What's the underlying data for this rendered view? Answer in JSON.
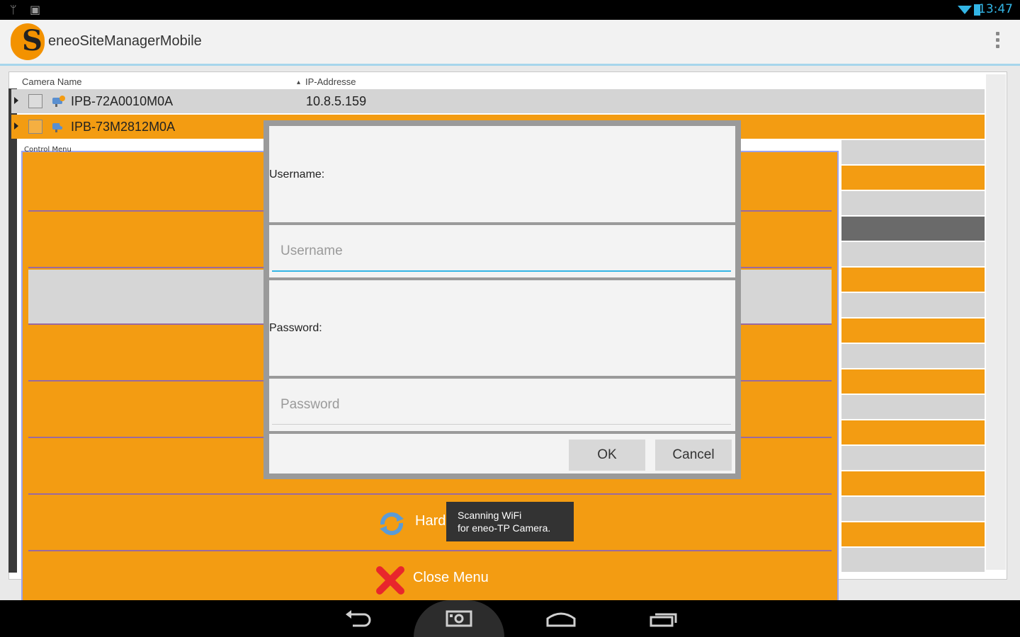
{
  "status_bar": {
    "time": "13:47"
  },
  "app": {
    "title": "eneoSiteManagerMobile"
  },
  "table": {
    "headers": {
      "camera_name": "Camera Name",
      "ip_address": "IP-Addresse"
    },
    "rows": [
      {
        "name": "IPB-72A0010M0A",
        "ip": "10.8.5.159"
      },
      {
        "name": "IPB-73M2812M0A",
        "ip": ""
      }
    ]
  },
  "control_menu": {
    "legend": "Control Menu",
    "hard_label": "Hard",
    "close_label": "Close Menu"
  },
  "dialog": {
    "username_label": "Username:",
    "username_placeholder": "Username",
    "password_label": "Password:",
    "password_placeholder": "Password",
    "ok_label": "OK",
    "cancel_label": "Cancel"
  },
  "toast": {
    "line1": "Scanning WiFi",
    "line2": "for eneo-TP Camera."
  },
  "colors": {
    "accent_orange": "#f39c12",
    "holo_blue": "#33b5e5"
  }
}
